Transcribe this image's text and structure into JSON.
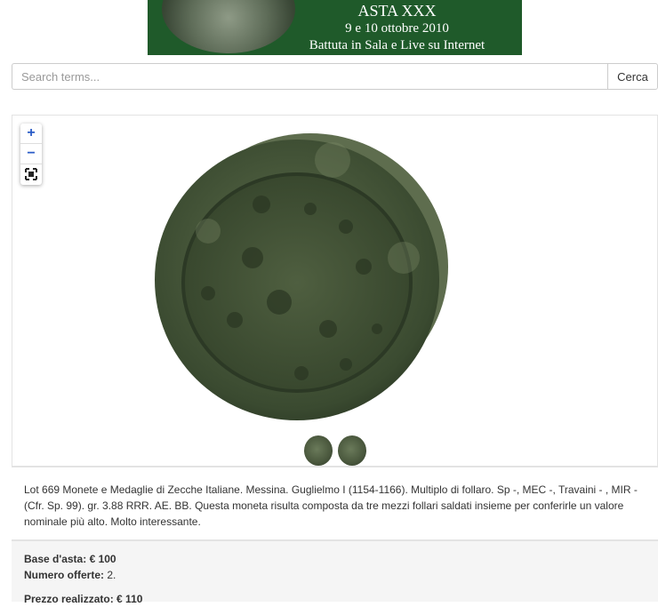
{
  "banner": {
    "title": "ASTA XXX",
    "dates": "9 e 10 ottobre 2010",
    "subtitle": "Battuta in Sala e Live su Internet"
  },
  "search": {
    "placeholder": "Search terms...",
    "button_label": "Cerca"
  },
  "viewer": {
    "zoom_in": "+",
    "zoom_out": "−"
  },
  "lot": {
    "description": "Lot 669 Monete e Medaglie di Zecche Italiane. Messina. Guglielmo I (1154-1166). Multiplo di follaro. Sp -, MEC -, Travaini - , MIR - (Cfr. Sp. 99). gr. 3.88 RRR. AE. BB. Questa moneta risulta composta da tre mezzi follari saldati insieme per conferirle un valore nominale più alto. Molto interessante."
  },
  "info": {
    "base_label": "Base d'asta:",
    "base_value": "€ 100",
    "offers_label": "Numero offerte:",
    "offers_value": "2.",
    "price_label": "Prezzo realizzato:",
    "price_value": "€ 110"
  }
}
